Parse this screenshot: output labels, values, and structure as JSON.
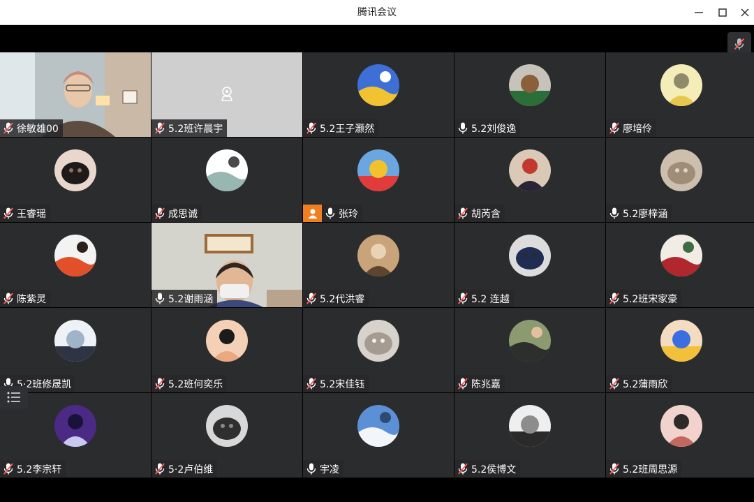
{
  "window": {
    "title": "腾讯会议"
  },
  "participants": [
    {
      "name": "徐敏雄00",
      "mic": "muted",
      "kind": "camera-woman",
      "colors": [
        "#9aa8a6",
        "#5d4c3f"
      ]
    },
    {
      "name": "5.2班许晨宇",
      "mic": "muted",
      "kind": "camera-off",
      "colors": [
        "#cfcfcf",
        "#ffffff"
      ]
    },
    {
      "name": "5.2王子灏然",
      "mic": "muted",
      "kind": "avatar",
      "colors": [
        "#3d6fd6",
        "#f1c232",
        "#ffffff"
      ]
    },
    {
      "name": "5.2刘俊逸",
      "mic": "on",
      "kind": "avatar",
      "colors": [
        "#c7c2ba",
        "#2c6e37",
        "#8b5e3c"
      ]
    },
    {
      "name": "廖培伶",
      "mic": "muted",
      "kind": "avatar",
      "colors": [
        "#f4edb7",
        "#e7c84f",
        "#8f8a6a"
      ]
    },
    {
      "name": "王睿瑶",
      "mic": "muted",
      "kind": "avatar",
      "colors": [
        "#e9d6cc",
        "#1e1a1a",
        "#8c6f66"
      ]
    },
    {
      "name": "成思诚",
      "mic": "muted",
      "kind": "avatar",
      "colors": [
        "#ffffff",
        "#98b7b0",
        "#4a4a4a"
      ]
    },
    {
      "name": "张玲",
      "mic": "on",
      "kind": "avatar",
      "badge": "orange",
      "colors": [
        "#6aa6e0",
        "#e23b3b",
        "#f2c12e"
      ]
    },
    {
      "name": "胡芮含",
      "mic": "muted",
      "kind": "avatar",
      "colors": [
        "#d9c9b6",
        "#2b2437",
        "#c23a2f"
      ]
    },
    {
      "name": "5.2廖梓涵",
      "mic": "on",
      "kind": "avatar",
      "colors": [
        "#cdbfae",
        "#a08d78",
        "#e0d6c8"
      ]
    },
    {
      "name": "陈紫灵",
      "mic": "muted",
      "kind": "avatar",
      "colors": [
        "#f3f3f3",
        "#e2502a",
        "#2b1f1a"
      ]
    },
    {
      "name": "5.2谢雨涵",
      "mic": "on",
      "kind": "camera-child",
      "colors": [
        "#d6d6d0",
        "#3b4a7a",
        "#f0f0f0"
      ]
    },
    {
      "name": "5.2代洪睿",
      "mic": "muted",
      "kind": "avatar",
      "colors": [
        "#c9a37a",
        "#5d4630",
        "#e8d3b5"
      ]
    },
    {
      "name": "5.2 连越",
      "mic": "muted",
      "kind": "avatar",
      "colors": [
        "#dcdcdc",
        "#1f2d52",
        "#2a2a2a"
      ]
    },
    {
      "name": "5.2班宋家豪",
      "mic": "muted",
      "kind": "avatar",
      "colors": [
        "#f1ece4",
        "#b0272e",
        "#3f6b45"
      ]
    },
    {
      "name": "5·2班修晟凯",
      "mic": "on",
      "kind": "avatar",
      "colors": [
        "#eef2f6",
        "#2e3443",
        "#9fb3c9"
      ]
    },
    {
      "name": "5.2班何奕乐",
      "mic": "muted",
      "kind": "avatar",
      "colors": [
        "#f3d0b6",
        "#e9a87e",
        "#1b1b1b"
      ]
    },
    {
      "name": "5.2宋佳钰",
      "mic": "muted",
      "kind": "avatar",
      "colors": [
        "#d7d2cc",
        "#a59b93",
        "#f3efe9"
      ]
    },
    {
      "name": "陈兆嘉",
      "mic": "muted",
      "kind": "avatar",
      "colors": [
        "#8c9a70",
        "#2d2f2d",
        "#e3c0a0"
      ]
    },
    {
      "name": "5.2蒲雨欣",
      "mic": "muted",
      "kind": "avatar",
      "colors": [
        "#f3dcc0",
        "#f2c03a",
        "#3b6ee0"
      ]
    },
    {
      "name": "5.2李宗轩",
      "mic": "muted",
      "kind": "avatar",
      "colors": [
        "#4b2a86",
        "#c9c9ef",
        "#18133a"
      ]
    },
    {
      "name": "5·2卢伯维",
      "mic": "muted",
      "kind": "avatar",
      "colors": [
        "#d8d8d8",
        "#2f2f2f",
        "#8a8a8a"
      ]
    },
    {
      "name": "宇凌",
      "mic": "on",
      "kind": "avatar",
      "colors": [
        "#5b8fd6",
        "#f2f5fa",
        "#2e4a72"
      ]
    },
    {
      "name": "5.2侯博文",
      "mic": "muted",
      "kind": "avatar",
      "colors": [
        "#efefef",
        "#2a2a2a",
        "#8d8d8d"
      ]
    },
    {
      "name": "5.2班周思源",
      "mic": "muted",
      "kind": "avatar",
      "colors": [
        "#f1d2cc",
        "#c2685e",
        "#2e2a29"
      ]
    }
  ],
  "theme": {
    "tile_bg": "#2b2c2e",
    "nametag_bg": "#28282a",
    "accent_orange": "#f07f22",
    "muted_icon": "#ff5b5b"
  },
  "icons": {
    "minimize": "minimize-icon",
    "maximize": "maximize-icon",
    "close": "close-icon",
    "mic_on": "mic-icon",
    "mic_muted": "mic-muted-icon",
    "list": "list-icon",
    "user": "user-icon",
    "camera_off": "camera-off-icon"
  }
}
